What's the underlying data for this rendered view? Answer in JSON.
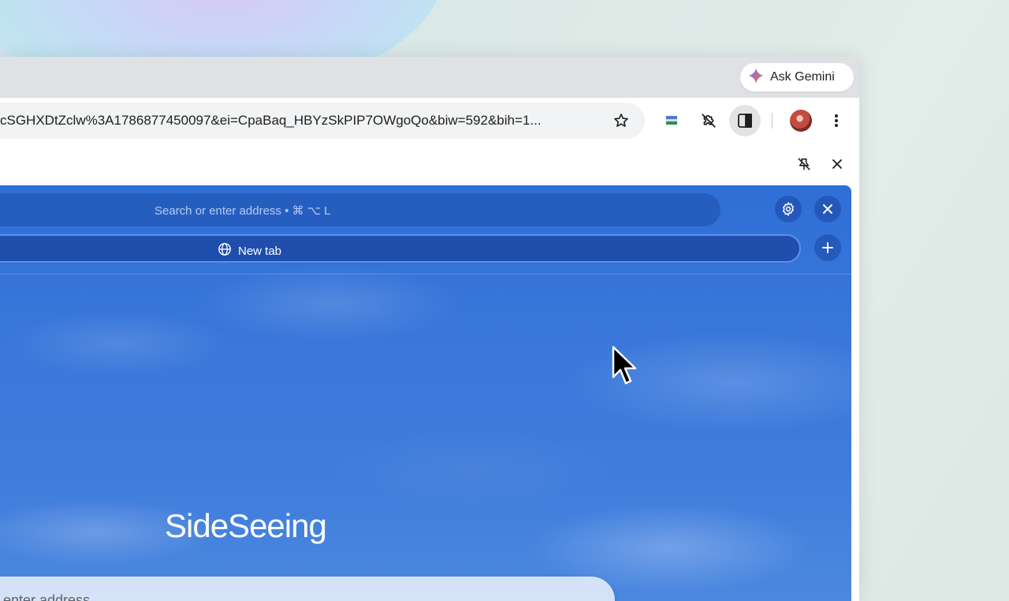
{
  "tabstrip": {
    "ask_gemini_label": "Ask Gemini"
  },
  "toolbar": {
    "url": "cSGHXDtZclw%3A1786877450097&ei=CpaBaq_HBYzSkPIP7OWgoQo&biw=592&bih=1...",
    "icons": [
      "star-icon",
      "extension-flag-icon",
      "puzzle-off-icon",
      "side-panel-icon",
      "avatar",
      "more-vert-icon"
    ]
  },
  "side_panel": {
    "header_icons": [
      "unpin-icon",
      "close-icon"
    ],
    "search_placeholder": "Search or enter address • ⌘ ⌥ L",
    "tab_label": "New tab",
    "brand": "SideSeeing",
    "address_placeholder": "enter address"
  },
  "colors": {
    "panel_blue": "#2f6fd6",
    "tab_border": "#5b8ff0"
  }
}
